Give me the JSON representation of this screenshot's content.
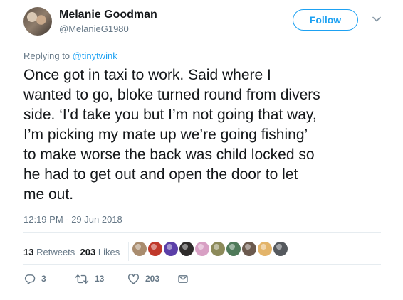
{
  "author": {
    "display_name": "Melanie Goodman",
    "handle": "@MelanieG1980"
  },
  "header": {
    "follow_label": "Follow",
    "menu_icon": "chevron-down-icon"
  },
  "reply_context": {
    "prefix": "Replying to",
    "mention": "@tinytwink"
  },
  "tweet": {
    "lines": [
      "Once got in taxi to work. Said where I",
      "wanted to go, bloke turned round from divers",
      "side. ‘I’d take you but I’m not going that way,",
      "I’m picking my mate up we’re going fishing’",
      "to make worse the back was child locked so",
      "he had to get out and open the door to let",
      "me out."
    ],
    "timestamp": "12:19 PM - 29 Jun 2018"
  },
  "stats": {
    "retweets_count": "13",
    "retweets_label": "Retweets",
    "likes_count": "203",
    "likes_label": "Likes"
  },
  "likers": [
    {
      "name": "liker-avatar-1",
      "color": "#a98c6e"
    },
    {
      "name": "liker-avatar-2",
      "color": "#c0392b"
    },
    {
      "name": "liker-avatar-3",
      "color": "#5b3fa8"
    },
    {
      "name": "liker-avatar-4",
      "color": "#2e2b2a"
    },
    {
      "name": "liker-avatar-5",
      "color": "#d8a0c4"
    },
    {
      "name": "liker-avatar-6",
      "color": "#8c8a5a"
    },
    {
      "name": "liker-avatar-7",
      "color": "#4f7a5a"
    },
    {
      "name": "liker-avatar-8",
      "color": "#6b5a4e"
    },
    {
      "name": "liker-avatar-9",
      "color": "#e3b46a"
    },
    {
      "name": "liker-avatar-10",
      "color": "#55595e"
    }
  ],
  "actions": {
    "reply_count": "3",
    "retweet_count": "13",
    "like_count": "203"
  },
  "colors": {
    "accent": "#1da1f2",
    "secondary_text": "#657786",
    "primary_text": "#14171a",
    "divider": "#e6ecf0"
  }
}
